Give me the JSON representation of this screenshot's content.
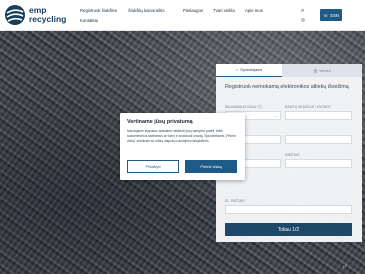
{
  "header": {
    "logo": {
      "line1": "emp",
      "line2": "recycling"
    },
    "nav": [
      {
        "label": "Registruok šiukšles"
      },
      {
        "label": "Šiukšlių kainoraštis"
      },
      {
        "label": "Paslaugos"
      },
      {
        "label": "Tvari veikla"
      },
      {
        "label": "Apie mus"
      },
      {
        "label": "Kontaktai"
      }
    ],
    "cta_label": "ESN"
  },
  "form": {
    "tabs": [
      {
        "label": "Gyventojams",
        "active": true
      },
      {
        "label": "Verslui"
      }
    ],
    "title": "Registruok nemokamą elektronikos atliekų išvežimą",
    "labels": {
      "lbl_r1_left": "ŠALINAMA ATLIEKA *",
      "lbl_r1_right": "DAIKTŲ SKAIČIUS / SVORIS*",
      "lbl_r2_right": "MIESTAS",
      "lbl_r3": "EL. PAŠTAS*"
    },
    "submit_label": "Toliau 1/2"
  },
  "modal": {
    "title": "Vertiname jūsų privatumą",
    "text": "Naudojame slapukus siekdami užtikrinti jūsų naršymo patirtį, teikti suasmenintus skelbimus ar turinį ir analizuoti srautą. Spustelėdami „Priimti viską\" sutinkate su mūsų slapukų naudojimo taisyklėmis.",
    "decline_label": "Pritaikyti",
    "accept_label": "Priimti viską"
  },
  "language": "LT"
}
